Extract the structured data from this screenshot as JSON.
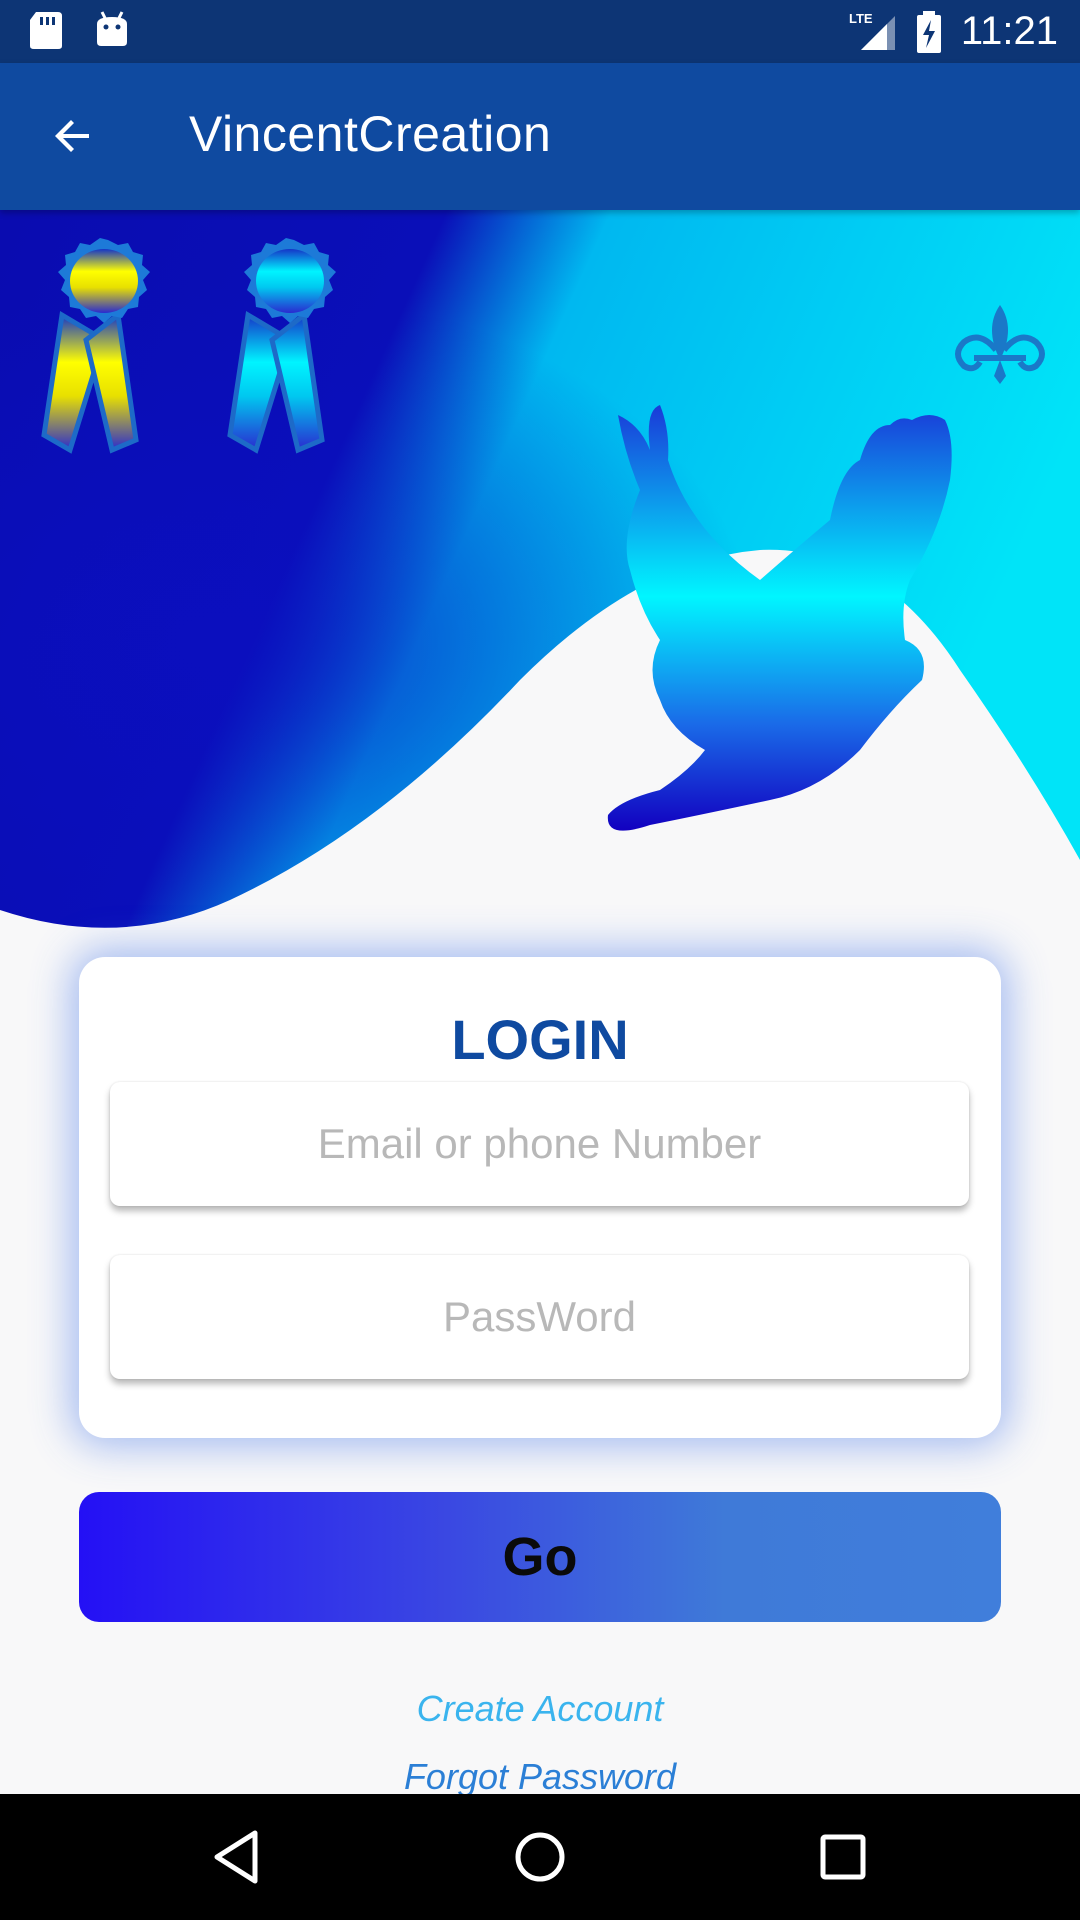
{
  "status_bar": {
    "time": "11:21",
    "network": "LTE",
    "icons": [
      "sd-card-icon",
      "android-icon",
      "lte-signal-icon",
      "battery-charging-icon"
    ]
  },
  "app_bar": {
    "title": "VincentCreation",
    "back_icon": "arrow-back-icon"
  },
  "hero": {
    "decorations": [
      "ribbon-award-icon",
      "ribbon-award-icon",
      "fleur-de-lis-icon",
      "dove-icon"
    ],
    "colors": {
      "deep_blue": "#0b0fb5",
      "cyan": "#00d8f5",
      "white": "#f8f8f9"
    }
  },
  "login": {
    "title": "LOGIN",
    "email_placeholder": "Email or phone Number",
    "email_value": "",
    "password_placeholder": "PassWord",
    "password_value": ""
  },
  "go_button": {
    "label": "Go"
  },
  "links": {
    "create_account": "Create Account",
    "forgot_password": "Forgot Password"
  },
  "nav_bar": {
    "icons": [
      "nav-back-icon",
      "nav-home-icon",
      "nav-recents-icon"
    ]
  },
  "colors": {
    "status_bar": "#0d3575",
    "app_bar": "#0f4aa0",
    "login_title": "#0f4aa0",
    "go_gradient_start": "#2410f5",
    "go_gradient_end": "#407edb",
    "link_create": "#3ab4ee",
    "link_forgot": "#2b7fd6"
  }
}
